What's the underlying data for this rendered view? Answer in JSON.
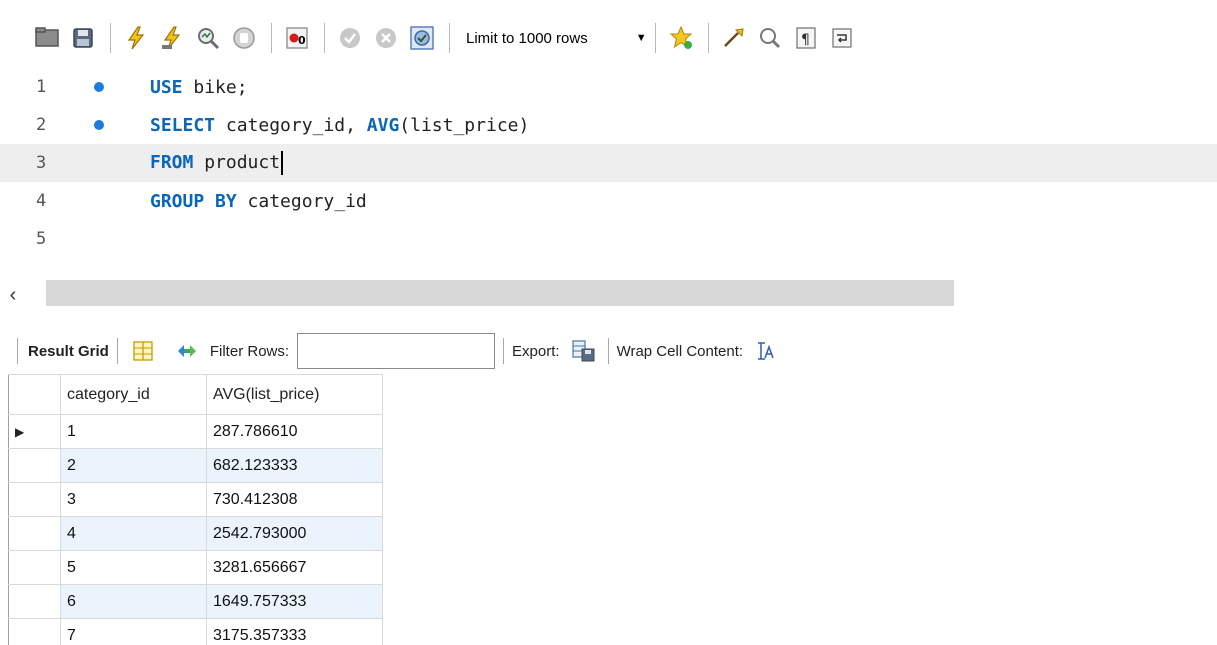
{
  "toolbar": {
    "limit_label": "Limit to 1000 rows",
    "icons": [
      "folder-open-icon",
      "save-icon",
      "execute-icon",
      "execute-current-icon",
      "explain-icon",
      "stop-icon",
      "toggle-error-icon",
      "commit-icon",
      "rollback-icon",
      "autocommit-icon",
      "bookmark-icon",
      "beautify-icon",
      "find-icon",
      "invisible-chars-icon",
      "wrap-icon"
    ]
  },
  "editor": {
    "lines": [
      {
        "number": "1",
        "text": "bike;",
        "keyword": "USE",
        "has_dot": true
      },
      {
        "number": "2",
        "text": "category_id, ",
        "keyword": "SELECT",
        "fn": "AVG",
        "rest": "(list_price)",
        "has_dot": true
      },
      {
        "number": "3",
        "text": "product",
        "keyword": "FROM",
        "has_dot": false
      },
      {
        "number": "4",
        "text": "category_id",
        "keyword": "GROUP BY",
        "has_dot": false
      },
      {
        "number": "5",
        "text": "",
        "has_dot": false
      }
    ]
  },
  "scroll": {
    "left_arrow": "‹"
  },
  "results": {
    "tab_label": "Result Grid",
    "filter_label": "Filter Rows:",
    "filter_value": "",
    "export_label": "Export:",
    "wrap_label": "Wrap Cell Content:",
    "columns": [
      "category_id",
      "AVG(list_price)"
    ],
    "rows": [
      [
        "1",
        "287.786610"
      ],
      [
        "2",
        "682.123333"
      ],
      [
        "3",
        "730.412308"
      ],
      [
        "4",
        "2542.793000"
      ],
      [
        "5",
        "3281.656667"
      ],
      [
        "6",
        "1649.757333"
      ],
      [
        "7",
        "3175.357333"
      ]
    ],
    "current_row_marker": "▶"
  }
}
